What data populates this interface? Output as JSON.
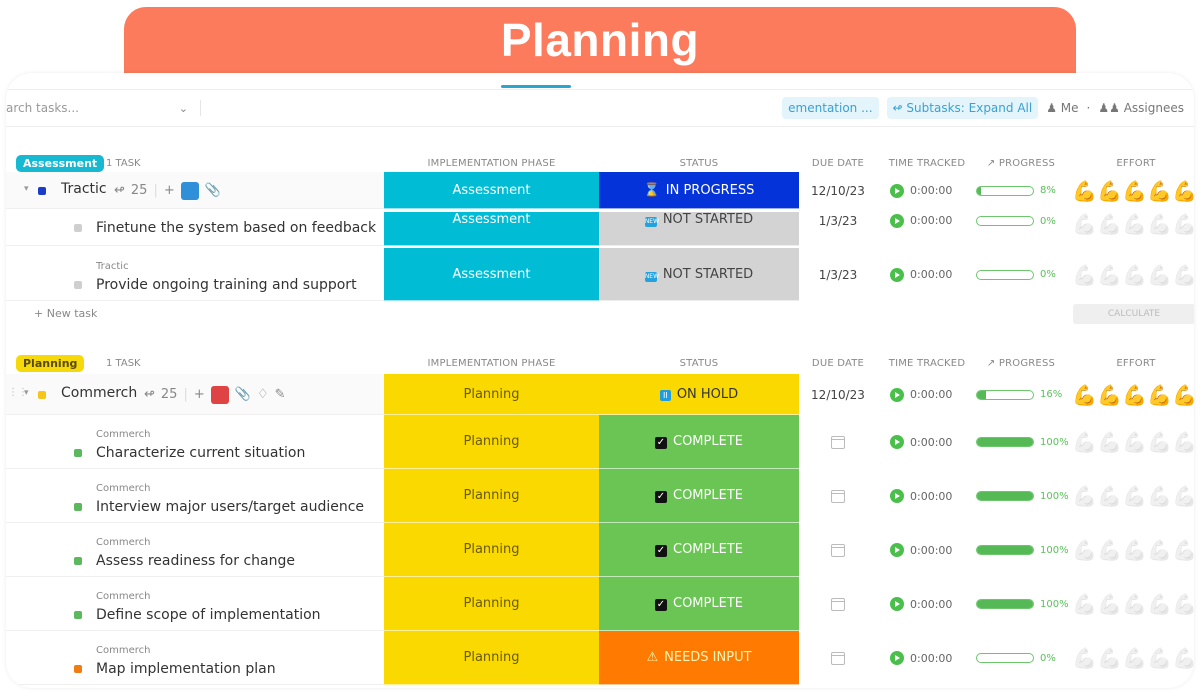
{
  "banner": {
    "title": "Planning",
    "color": "#fb7b5c"
  },
  "toolbar": {
    "search_placeholder": "arch tasks...",
    "chip_impl": "ementation ...",
    "chip_subtasks": "Subtasks: Expand All",
    "me": "Me",
    "assignees": "Assignees"
  },
  "columns": {
    "phase": "IMPLEMENTATION PHASE",
    "status": "STATUS",
    "due": "DUE DATE",
    "time": "TIME TRACKED",
    "progress": "PROGRESS",
    "effort": "EFFORT"
  },
  "groups": [
    {
      "tag": "Assessment",
      "tag_color": "#17b8d2",
      "count": "1 TASK",
      "parent": {
        "name": "Tractic",
        "subtasks": "25",
        "phase": "Assessment",
        "status": "IN PROGRESS",
        "status_icon": "hourglass",
        "due": "12/10/23",
        "time": "0:00:00",
        "progress": 8,
        "progress_label": "8%",
        "effort": 5
      },
      "tasks": [
        {
          "parent": "",
          "name": "Finetune the system based on feedback",
          "phase": "Assessment",
          "status": "NOT STARTED",
          "status_icon": "new",
          "due": "1/3/23",
          "time": "0:00:00",
          "progress": 0,
          "progress_label": "0%",
          "effort": 0
        },
        {
          "parent": "Tractic",
          "name": "Provide ongoing training and support",
          "phase": "Assessment",
          "status": "NOT STARTED",
          "status_icon": "new",
          "due": "1/3/23",
          "time": "0:00:00",
          "progress": 0,
          "progress_label": "0%",
          "effort": 0
        }
      ],
      "new_task": "+ New task",
      "calculate": "CALCULATE"
    },
    {
      "tag": "Planning",
      "tag_color": "#f5d90a",
      "count": "1 TASK",
      "parent": {
        "name": "Commerch",
        "subtasks": "25",
        "phase": "Planning",
        "status": "ON HOLD",
        "status_icon": "pause",
        "due": "12/10/23",
        "time": "0:00:00",
        "progress": 16,
        "progress_label": "16%",
        "effort": 5
      },
      "tasks": [
        {
          "parent": "Commerch",
          "name": "Characterize current situation",
          "phase": "Planning",
          "status": "COMPLETE",
          "status_icon": "check",
          "due": "",
          "time": "0:00:00",
          "progress": 100,
          "progress_label": "100%",
          "effort": 0
        },
        {
          "parent": "Commerch",
          "name": "Interview major users/target audience",
          "phase": "Planning",
          "status": "COMPLETE",
          "status_icon": "check",
          "due": "",
          "time": "0:00:00",
          "progress": 100,
          "progress_label": "100%",
          "effort": 0
        },
        {
          "parent": "Commerch",
          "name": "Assess readiness for change",
          "phase": "Planning",
          "status": "COMPLETE",
          "status_icon": "check",
          "due": "",
          "time": "0:00:00",
          "progress": 100,
          "progress_label": "100%",
          "effort": 0
        },
        {
          "parent": "Commerch",
          "name": "Define scope of implementation",
          "phase": "Planning",
          "status": "COMPLETE",
          "status_icon": "check",
          "due": "",
          "time": "0:00:00",
          "progress": 100,
          "progress_label": "100%",
          "effort": 0
        },
        {
          "parent": "Commerch",
          "name": "Map implementation plan",
          "phase": "Planning",
          "status": "NEEDS INPUT",
          "status_icon": "warning",
          "due": "",
          "time": "0:00:00",
          "progress": 0,
          "progress_label": "0%",
          "effort": 0
        }
      ]
    }
  ],
  "colors": {
    "assessment": "#00bcd4",
    "planning": "#f9d900",
    "in_progress": "#0433d9",
    "not_started": "#d3d3d3",
    "on_hold": "#f9d900",
    "complete": "#6ac554",
    "needs_input": "#ff7a00"
  }
}
